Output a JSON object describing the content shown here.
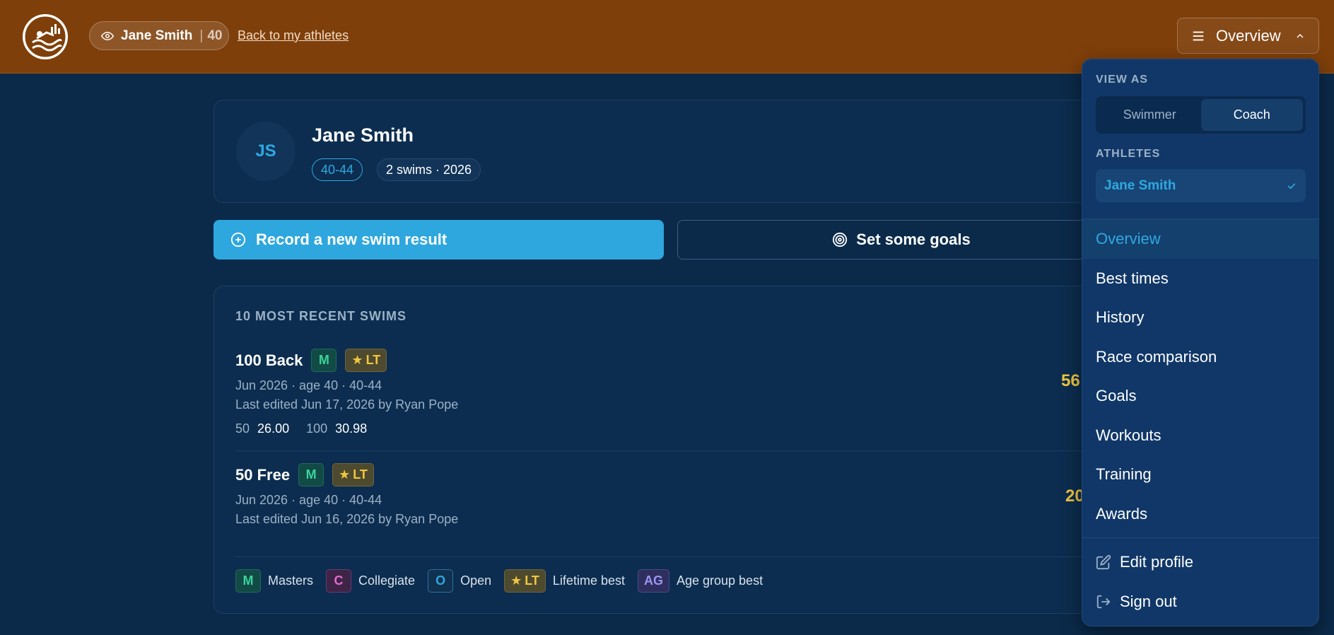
{
  "header": {
    "viewing_name": "Jane Smith",
    "viewing_age": "40",
    "back_link": "Back to my athletes",
    "nav_toggle_label": "Overview"
  },
  "profile": {
    "initials": "JS",
    "name": "Jane Smith",
    "age_group": "40-44",
    "summary": "2 swims · 2026"
  },
  "actions": {
    "record_label": "Record a new swim result",
    "goals_label": "Set some goals"
  },
  "recent": {
    "title": "10 MOST RECENT SWIMS",
    "swims": [
      {
        "event": "100 Back",
        "badge_m": "M",
        "badge_lt": "LT",
        "meta": "Jun 2026 · age 40 · 40-44",
        "edited": "Last edited Jun 17, 2026 by Ryan Pope",
        "time": "56",
        "splits": [
          {
            "label": "50",
            "value": "26.00"
          },
          {
            "label": "100",
            "value": "30.98"
          }
        ]
      },
      {
        "event": "50 Free",
        "badge_m": "M",
        "badge_lt": "LT",
        "meta": "Jun 2026 · age 40 · 40-44",
        "edited": "Last edited Jun 16, 2026 by Ryan Pope",
        "time": "20"
      }
    ],
    "legend": [
      {
        "code": "M",
        "label": "Masters"
      },
      {
        "code": "C",
        "label": "Collegiate"
      },
      {
        "code": "O",
        "label": "Open"
      },
      {
        "code": "LT",
        "label": "Lifetime best"
      },
      {
        "code": "AG",
        "label": "Age group best"
      }
    ]
  },
  "menu": {
    "view_as_label": "VIEW AS",
    "view_options": [
      "Swimmer",
      "Coach"
    ],
    "view_selected": "Coach",
    "athletes_label": "ATHLETES",
    "athlete_selected": "Jane Smith",
    "items": [
      "Overview",
      "Best times",
      "History",
      "Race comparison",
      "Goals",
      "Workouts",
      "Training",
      "Awards"
    ],
    "active_item": "Overview",
    "edit_profile": "Edit profile",
    "sign_out": "Sign out"
  },
  "colors": {
    "header_bg": "#7f3f0a",
    "page_bg": "#0b2a4a",
    "accent": "#2ea7df",
    "gold": "#f0c640"
  }
}
